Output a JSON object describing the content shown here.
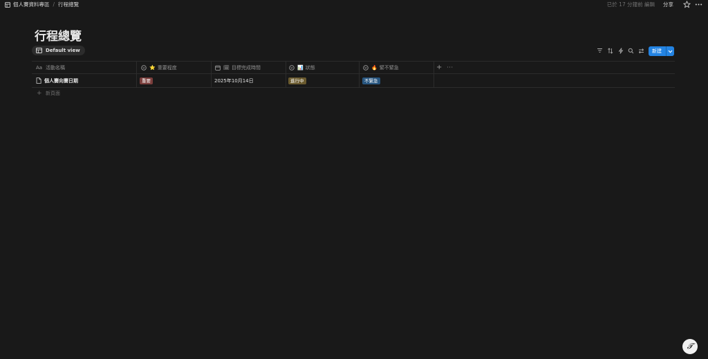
{
  "breadcrumb": {
    "workspace": "個人賽資料專區",
    "page": "行程總覽"
  },
  "topbar": {
    "edited": "已於 17 分鐘前 編輯",
    "share": "分享"
  },
  "page": {
    "title": "行程總覽"
  },
  "view": {
    "tab_label": "Default view",
    "new_button": "新建"
  },
  "table": {
    "columns": [
      {
        "label": "活動名稱",
        "icon": "aa-text-icon",
        "emoji": ""
      },
      {
        "label": "重要程度",
        "icon": "select-icon",
        "emoji": "⭐"
      },
      {
        "label": "目標完成時間",
        "icon": "calendar-icon",
        "emoji": "🗓"
      },
      {
        "label": "狀態",
        "icon": "select-icon",
        "emoji": "📊"
      },
      {
        "label": "緊不緊急",
        "icon": "select-icon",
        "emoji": "🔥"
      }
    ],
    "rows": [
      {
        "name": "個人賽向賽日期",
        "importance": "重要",
        "due": "2025年10月14日",
        "status": "進行中",
        "urgency": "不緊急"
      }
    ],
    "new_row": "新頁面"
  },
  "colors": {
    "tag_important": "#7a3d3b",
    "tag_status": "#6a5a2e",
    "tag_urgency": "#285680",
    "accent": "#2383e2"
  }
}
